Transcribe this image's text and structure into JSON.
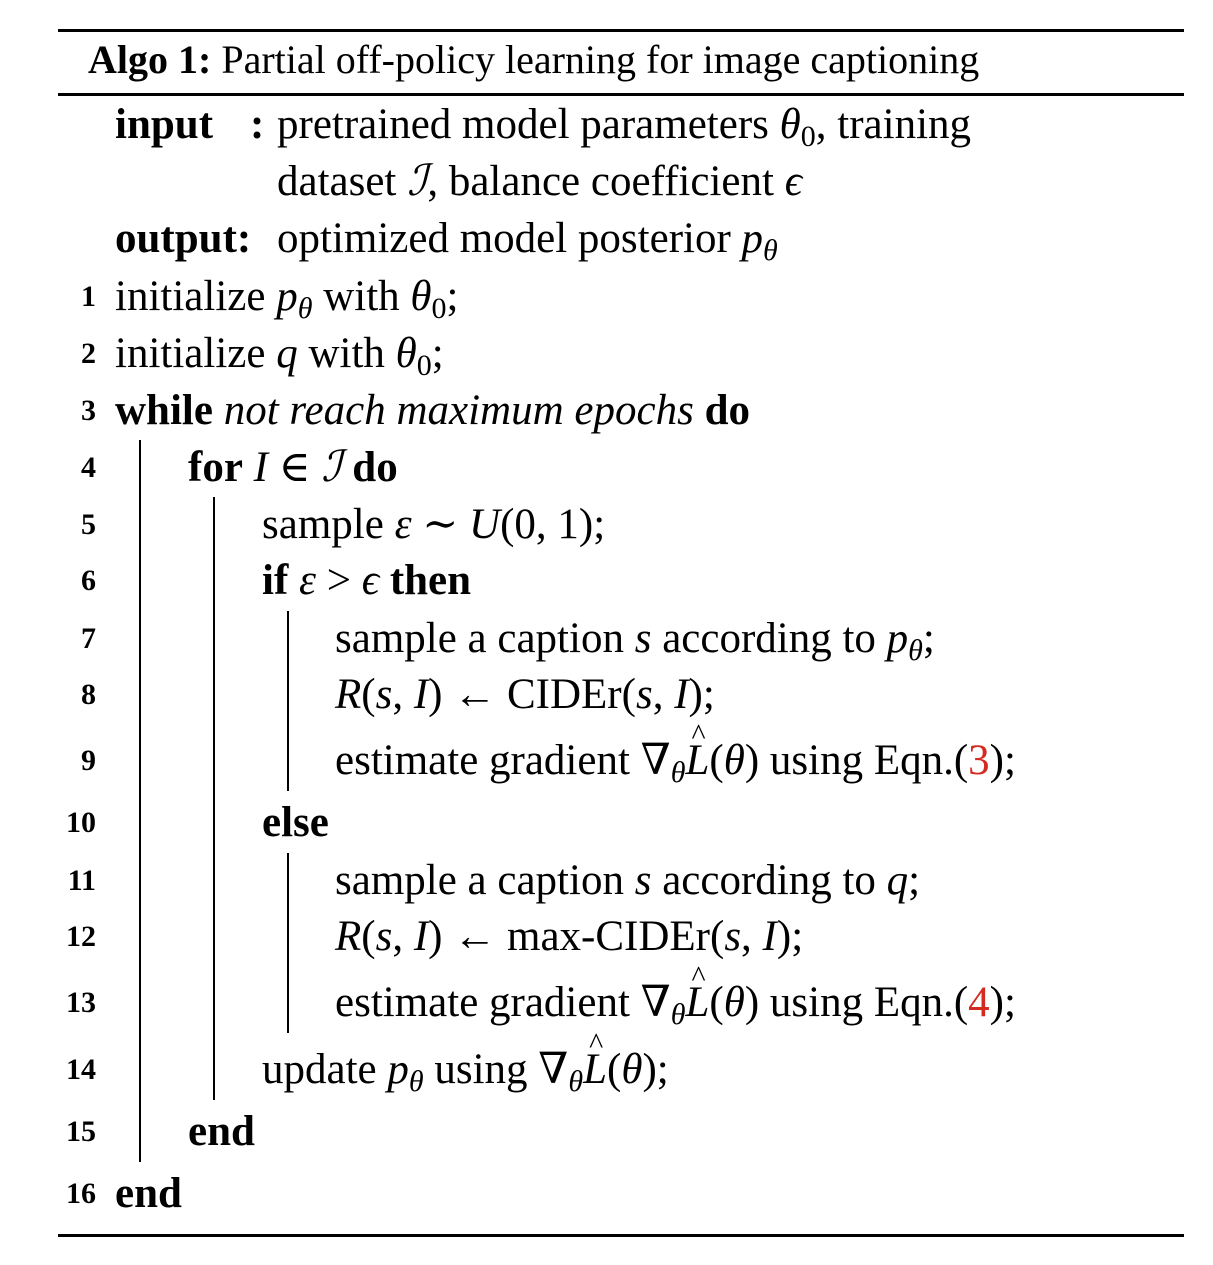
{
  "caption": {
    "label": "Algo 1:",
    "title": "Partial off-policy learning for image captioning"
  },
  "input": {
    "label": "input",
    "colon": ":",
    "line1": "pretrained model parameters θ₀, training",
    "line2": "dataset ℐ, balance coefficient ϵ"
  },
  "output": {
    "label": "output:",
    "text": "optimized model posterior p_θ"
  },
  "lines": [
    {
      "n": "1",
      "text": "initialize p_θ with θ₀;"
    },
    {
      "n": "2",
      "text": "initialize q with θ₀;"
    },
    {
      "n": "3",
      "text": "while not reach maximum epochs do"
    },
    {
      "n": "4",
      "text": "for I ∈ ℐ do"
    },
    {
      "n": "5",
      "text": "sample ε ∼ U(0, 1);"
    },
    {
      "n": "6",
      "text": "if ε > ϵ then"
    },
    {
      "n": "7",
      "text": "sample a caption s according to p_θ;"
    },
    {
      "n": "8",
      "text": "R(s, I) ← CIDEr(s, I);"
    },
    {
      "n": "9",
      "text": "estimate gradient ∇_θ L̂(θ) using Eqn.(3);"
    },
    {
      "n": "10",
      "text": "else"
    },
    {
      "n": "11",
      "text": "sample a caption s according to q;"
    },
    {
      "n": "12",
      "text": "R(s, I) ← max-CIDEr(s, I);"
    },
    {
      "n": "13",
      "text": "estimate gradient ∇_θ L̂(θ) using Eqn.(4);"
    },
    {
      "n": "14",
      "text": "update p_θ using ∇_θ L̂(θ);"
    },
    {
      "n": "15",
      "text": "end"
    },
    {
      "n": "16",
      "text": "end"
    }
  ],
  "eqn_refs": [
    "3",
    "4"
  ],
  "colors": {
    "text": "#000000",
    "reference": "#d42a20",
    "background": "#ffffff"
  }
}
